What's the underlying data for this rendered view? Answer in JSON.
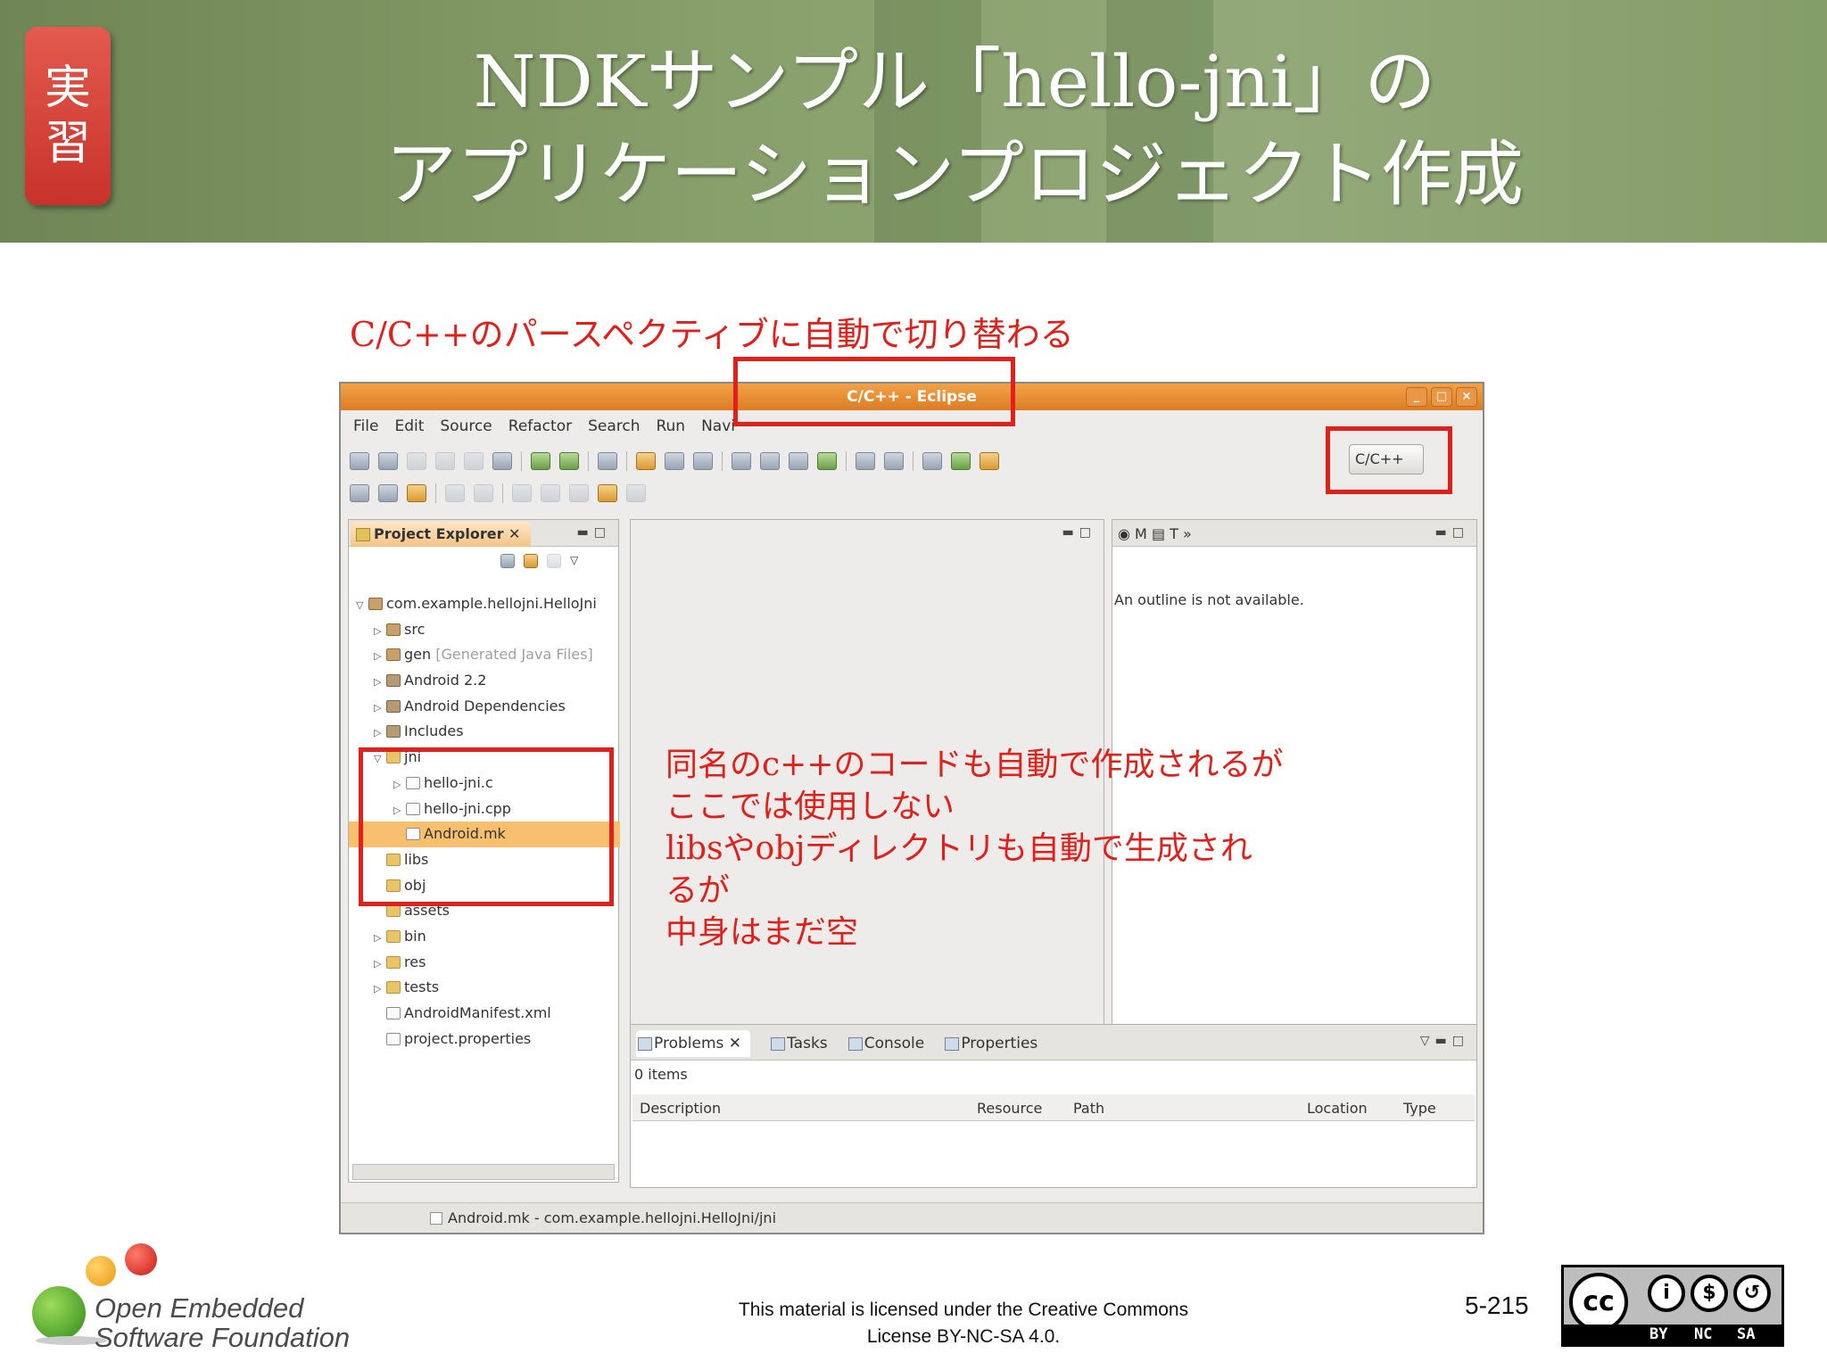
{
  "slide": {
    "badge": "実習",
    "title_line1": "NDKサンプル「hello-jni」の",
    "title_line2": "アプリケーションプロジェクト作成",
    "caption_top": "C/C++のパースペクティブに自動で切り替わる",
    "note_lines": [
      "同名のc++のコードも自動で作成されるが",
      "ここでは使用しない",
      "libsやobjディレクトリも自動で生成され",
      "るが",
      "中身はまだ空"
    ],
    "red_color": "#e0201a"
  },
  "eclipse": {
    "window_title": "C/C++ - Eclipse",
    "menu": [
      "File",
      "Edit",
      "Source",
      "Refactor",
      "Search",
      "Run",
      "Navi"
    ],
    "perspective_button": "C/C++",
    "project_explorer": {
      "tab_label": "Project Explorer",
      "items": [
        {
          "label": "com.example.hellojni.HelloJni",
          "decoration": ""
        },
        {
          "label": "src",
          "decoration": ""
        },
        {
          "label": "gen",
          "decoration": "[Generated Java Files]"
        },
        {
          "label": "Android 2.2",
          "decoration": ""
        },
        {
          "label": "Android Dependencies",
          "decoration": ""
        },
        {
          "label": "Includes",
          "decoration": ""
        },
        {
          "label": "jni",
          "decoration": ""
        },
        {
          "label": "hello-jni.c",
          "decoration": ""
        },
        {
          "label": "hello-jni.cpp",
          "decoration": ""
        },
        {
          "label": "Android.mk",
          "decoration": ""
        },
        {
          "label": "libs",
          "decoration": ""
        },
        {
          "label": "obj",
          "decoration": ""
        },
        {
          "label": "assets",
          "decoration": ""
        },
        {
          "label": "bin",
          "decoration": ""
        },
        {
          "label": "res",
          "decoration": ""
        },
        {
          "label": "tests",
          "decoration": ""
        },
        {
          "label": "AndroidManifest.xml",
          "decoration": ""
        },
        {
          "label": "project.properties",
          "decoration": ""
        }
      ]
    },
    "outline": {
      "tab_letters": [
        "M",
        "T"
      ],
      "message": "An outline is not available."
    },
    "problems": {
      "tabs": [
        "Problems",
        "Tasks",
        "Console",
        "Properties"
      ],
      "count": "0 items",
      "columns": [
        "Description",
        "Resource",
        "Path",
        "Location",
        "Type"
      ]
    },
    "status_text": "Android.mk - com.example.hellojni.HelloJni/jni"
  },
  "footer": {
    "logo_line1": "Open Embedded",
    "logo_line2": "Software Foundation",
    "license_line1": "This material is licensed under the Creative Commons",
    "license_line2": "License BY-NC-SA 4.0.",
    "page_number": "5-215",
    "cc_labels": [
      "BY",
      "NC",
      "SA"
    ]
  }
}
